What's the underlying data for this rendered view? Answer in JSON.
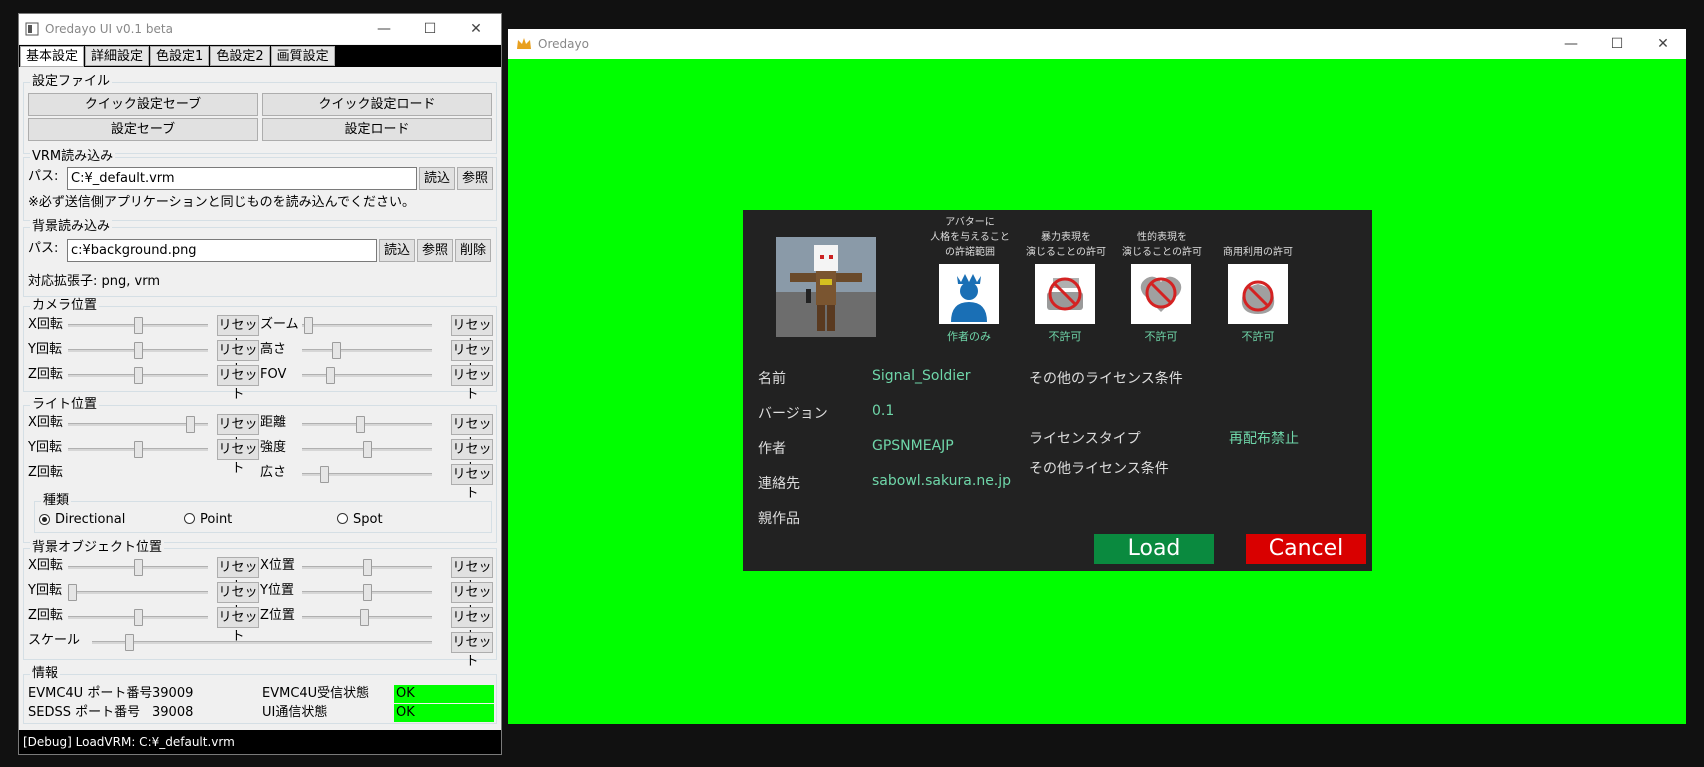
{
  "control": {
    "title": "Oredayo UI v0.1 beta",
    "tabs": [
      "基本設定",
      "詳細設定",
      "色設定1",
      "色設定2",
      "画質設定"
    ],
    "settings_file": {
      "label": "設定ファイル",
      "quick_save": "クイック設定セーブ",
      "quick_load": "クイック設定ロード",
      "save": "設定セーブ",
      "load": "設定ロード"
    },
    "vrm": {
      "label": "VRM読み込み",
      "path_label": "パス:",
      "path": "C:¥_default.vrm",
      "read": "読込",
      "browse": "参照",
      "note": "※必ず送信側アプリケーションと同じものを読み込んでください。"
    },
    "background": {
      "label": "背景読み込み",
      "path_label": "パス:",
      "path": "c:¥background.png",
      "read": "読込",
      "browse": "参照",
      "delete": "削除",
      "ext": "対応拡張子: png, vrm"
    },
    "camera": {
      "label": "カメラ位置",
      "xrot": "X回転",
      "yrot": "Y回転",
      "zrot": "Z回転",
      "zoom": "ズーム",
      "height": "高さ",
      "fov": "FOV",
      "reset": "リセット",
      "levels": {
        "xrot": 0.5,
        "yrot": 0.5,
        "zrot": 0.5,
        "zoom": 0.02,
        "height": 0.25,
        "fov": 0.2
      }
    },
    "light": {
      "label": "ライト位置",
      "xrot": "X回転",
      "yrot": "Y回転",
      "zrot": "Z回転",
      "distance": "距離",
      "intensity": "強度",
      "spread": "広さ",
      "reset": "リセット",
      "type_label": "種類",
      "types": [
        "Directional",
        "Point",
        "Spot"
      ],
      "selected": "Directional",
      "levels": {
        "xrot": 0.9,
        "yrot": 0.5,
        "distance": 0.45,
        "intensity": 0.5,
        "spread": 0.15
      }
    },
    "bgobject": {
      "label": "背景オブジェクト位置",
      "xrot": "X回転",
      "yrot": "Y回転",
      "zrot": "Z回転",
      "xpos": "X位置",
      "ypos": "Y位置",
      "zpos": "Z位置",
      "scale": "スケール",
      "reset": "リセット",
      "levels": {
        "xrot": 0.5,
        "yrot": 0.0,
        "zrot": 0.5,
        "xpos": 0.5,
        "ypos": 0.5,
        "zpos": 0.48,
        "scale": 0.1
      }
    },
    "info": {
      "label": "情報",
      "evmc_port_label": "EVMC4U ポート番号",
      "evmc_port": "39009",
      "sedss_port_label": "SEDSS ポート番号",
      "sedss_port": "39008",
      "evmc_recv_label": "EVMC4U受信状態",
      "evmc_recv": "OK",
      "ui_comm_label": "UI通信状態",
      "ui_comm": "OK"
    },
    "status": "[Debug] LoadVRM: C:¥_default.vrm"
  },
  "viewer": {
    "title": "Oredayo",
    "dialog": {
      "perm_heads": [
        [
          "アバターに",
          "人格を与えること",
          "の許諾範囲"
        ],
        [
          "暴力表現を",
          "演じることの許可"
        ],
        [
          "性的表現を",
          "演じることの許可"
        ],
        [
          "商用利用の許可"
        ]
      ],
      "perm_values": [
        "作者のみ",
        "不許可",
        "不許可",
        "不許可"
      ],
      "fields": [
        {
          "label": "名前",
          "value": "Signal_Soldier"
        },
        {
          "label": "バージョン",
          "value": "0.1"
        },
        {
          "label": "作者",
          "value": "GPSNMEAJP"
        },
        {
          "label": "連絡先",
          "value": "sabowl.sakura.ne.jp"
        },
        {
          "label": "親作品",
          "value": ""
        }
      ],
      "other_license_title": "その他のライセンス条件",
      "license_type_label": "ライセンスタイプ",
      "license_type_value": "再配布禁止",
      "other_license_label": "その他ライセンス条件",
      "load": "Load",
      "cancel": "Cancel",
      "colors": {
        "load": "#0a8a3f",
        "cancel": "#d90000",
        "accent": "#6fd6a9",
        "screen": "#00ff00"
      }
    }
  }
}
